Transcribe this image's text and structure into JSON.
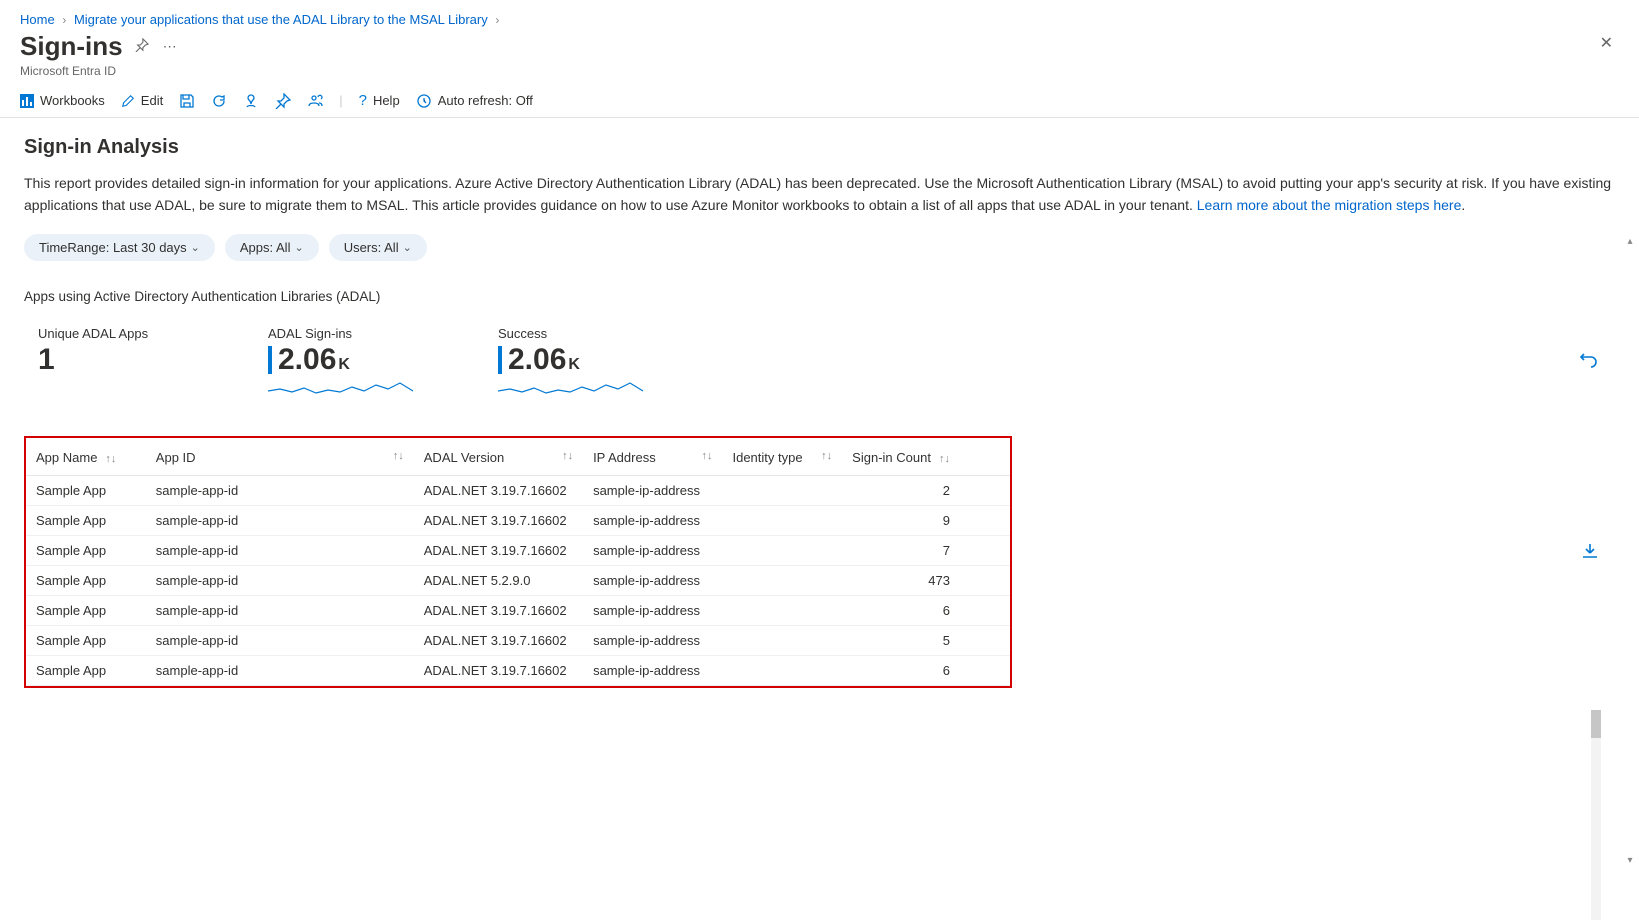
{
  "breadcrumb": {
    "home": "Home",
    "migrate": "Migrate your applications that use the ADAL Library to the MSAL Library"
  },
  "header": {
    "title": "Sign-ins",
    "subtitle": "Microsoft Entra ID"
  },
  "toolbar": {
    "workbooks": "Workbooks",
    "edit": "Edit",
    "help": "Help",
    "auto_refresh": "Auto refresh: Off"
  },
  "analysis": {
    "heading": "Sign-in Analysis",
    "body": "This report provides detailed sign-in information for your applications. Azure Active Directory Authentication Library (ADAL) has been deprecated. Use the Microsoft Authentication Library (MSAL) to avoid putting your app's security at risk. If you have existing applications that use ADAL, be sure to migrate them to MSAL. This article provides guidance on how to use Azure Monitor workbooks to obtain a list of all apps that use ADAL in your tenant. ",
    "link_text": "Learn more about the migration steps here",
    "period": "."
  },
  "filters": {
    "time": "TimeRange: Last 30 days",
    "apps": "Apps: All",
    "users": "Users: All"
  },
  "section_label": "Apps using Active Directory Authentication Libraries (ADAL)",
  "metrics": {
    "unique": {
      "label": "Unique ADAL Apps",
      "value": "1"
    },
    "signins": {
      "label": "ADAL Sign-ins",
      "value": "2.06",
      "unit": "K"
    },
    "success": {
      "label": "Success",
      "value": "2.06",
      "unit": "K"
    }
  },
  "table": {
    "columns": {
      "app_name": "App Name",
      "app_id": "App ID",
      "adal_version": "ADAL Version",
      "ip_address": "IP Address",
      "identity_type": "Identity type",
      "signin_count": "Sign-in Count"
    },
    "rows": [
      {
        "app_name": "Sample App",
        "app_id": "sample-app-id",
        "ver": "ADAL.NET 3.19.7.16602",
        "ip": "sample-ip-address",
        "identity": "",
        "count": "2"
      },
      {
        "app_name": "Sample App",
        "app_id": "sample-app-id",
        "ver": "ADAL.NET 3.19.7.16602",
        "ip": "sample-ip-address",
        "identity": "",
        "count": "9"
      },
      {
        "app_name": "Sample App",
        "app_id": "sample-app-id",
        "ver": "ADAL.NET 3.19.7.16602",
        "ip": "sample-ip-address",
        "identity": "",
        "count": "7"
      },
      {
        "app_name": "Sample App",
        "app_id": "sample-app-id",
        "ver": "ADAL.NET 5.2.9.0",
        "ip": "sample-ip-address",
        "identity": "",
        "count": "473"
      },
      {
        "app_name": "Sample App",
        "app_id": "sample-app-id",
        "ver": "ADAL.NET 3.19.7.16602",
        "ip": "sample-ip-address",
        "identity": "",
        "count": "6"
      },
      {
        "app_name": "Sample App",
        "app_id": "sample-app-id",
        "ver": "ADAL.NET 3.19.7.16602",
        "ip": "sample-ip-address",
        "identity": "",
        "count": "5"
      },
      {
        "app_name": "Sample App",
        "app_id": "sample-app-id",
        "ver": "ADAL.NET 3.19.7.16602",
        "ip": "sample-ip-address",
        "identity": "",
        "count": "6"
      }
    ]
  }
}
